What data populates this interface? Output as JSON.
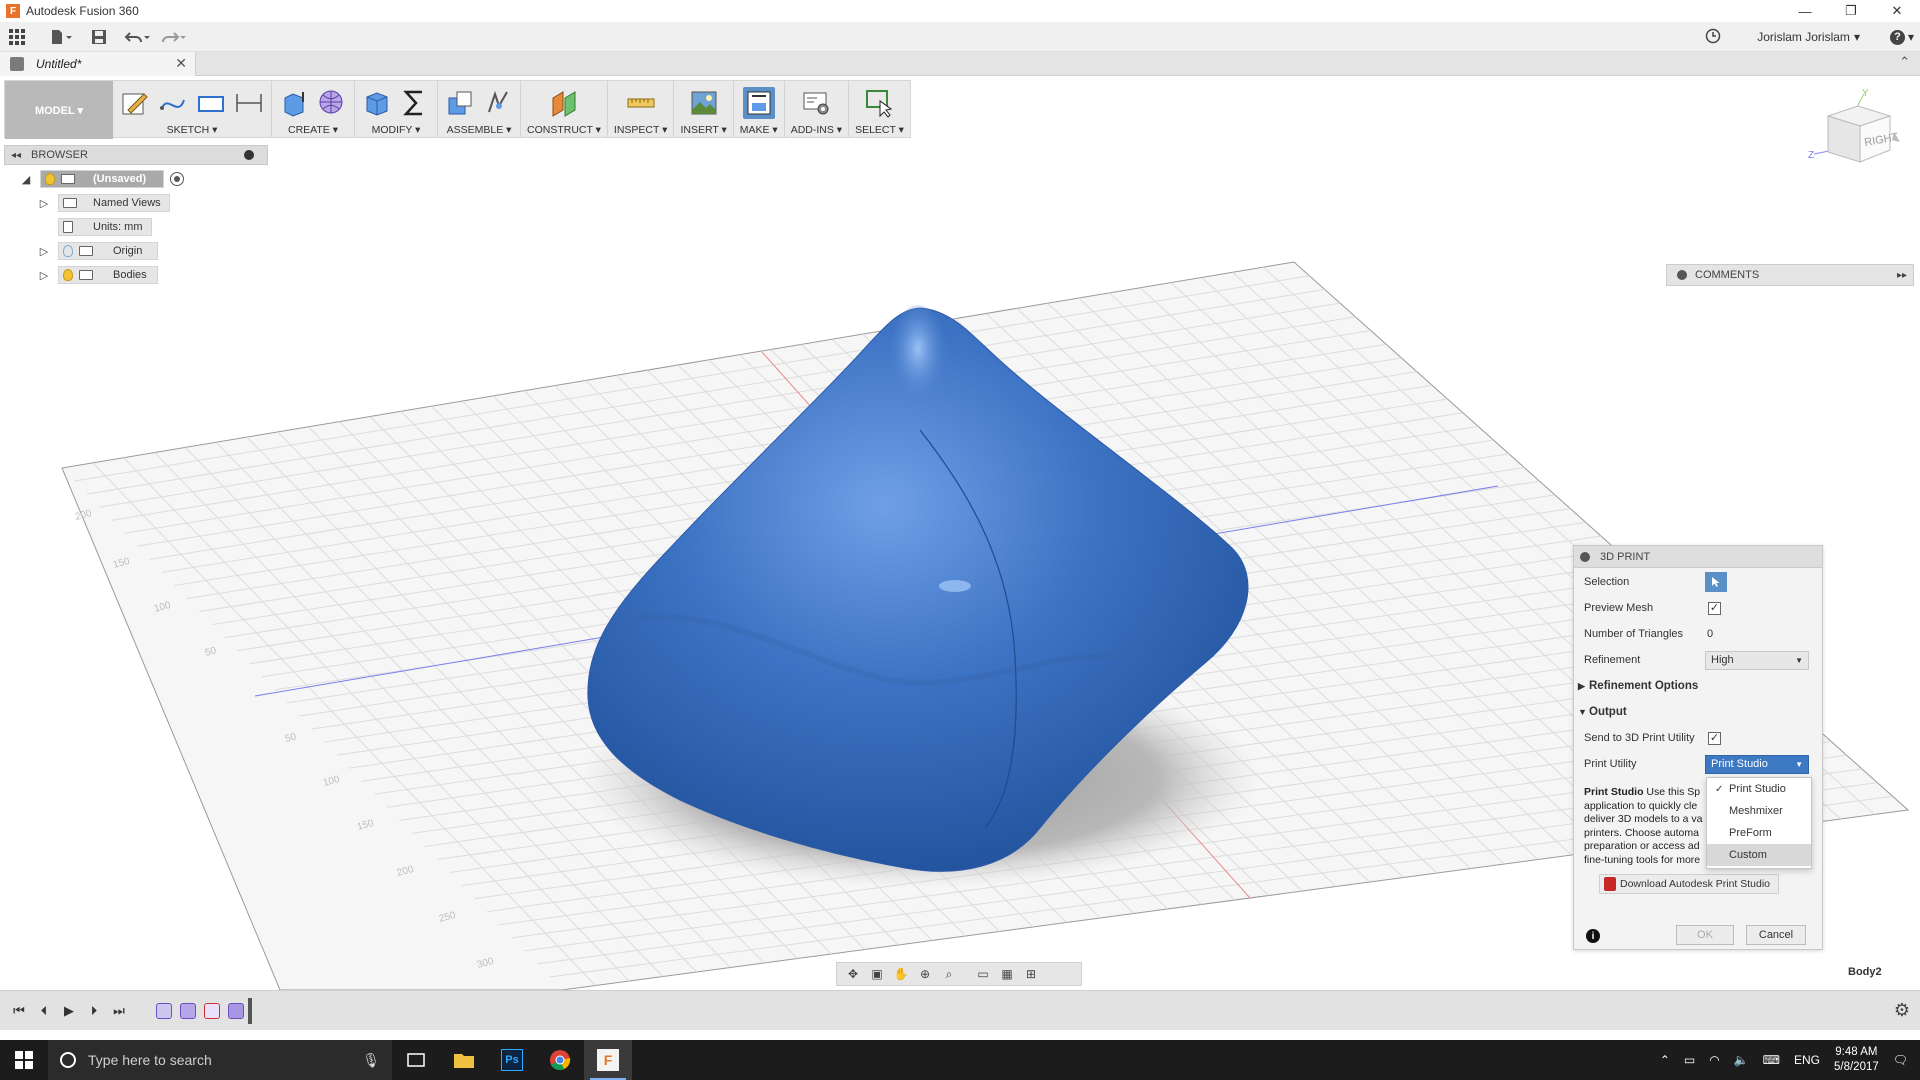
{
  "window": {
    "title": "Autodesk Fusion 360",
    "logo_letter": "F",
    "minimize": "—",
    "restore": "❐",
    "close": "✕"
  },
  "quickbar": {
    "user_name": "Jorislam Jorislam",
    "user_caret": "▾",
    "help_label": "?",
    "help_caret": "▾"
  },
  "document_tab": {
    "name": "Untitled*",
    "close": "✕",
    "collapse": "⌃"
  },
  "toolbar": {
    "mode_label": "MODEL ▾",
    "groups": [
      {
        "label": "SKETCH ▾"
      },
      {
        "label": "CREATE ▾"
      },
      {
        "label": "MODIFY ▾"
      },
      {
        "label": "ASSEMBLE ▾"
      },
      {
        "label": "CONSTRUCT ▾"
      },
      {
        "label": "INSPECT ▾"
      },
      {
        "label": "INSERT ▾"
      },
      {
        "label": "MAKE ▾"
      },
      {
        "label": "ADD-INS ▾"
      },
      {
        "label": "SELECT ▾"
      }
    ]
  },
  "browser": {
    "back": "◂◂",
    "title": "BROWSER",
    "tree": [
      {
        "label": "(Unsaved)"
      },
      {
        "label": "Named Views"
      },
      {
        "label": "Units: mm"
      },
      {
        "label": "Origin"
      },
      {
        "label": "Bodies"
      }
    ]
  },
  "viewcube": {
    "face_label": "RIGHT",
    "axis_y": "Y",
    "axis_z": "Z"
  },
  "grid_ticks": [
    "200",
    "150",
    "100",
    "50",
    "50",
    "100",
    "150",
    "200",
    "250",
    "300"
  ],
  "comments": {
    "title": "COMMENTS",
    "expand": "▸▸"
  },
  "print_dialog": {
    "title": "3D PRINT",
    "selection_label": "Selection",
    "preview_mesh_label": "Preview Mesh",
    "preview_mesh_checked": "✓",
    "triangles_label": "Number of Triangles",
    "triangles_value": "0",
    "refinement_label": "Refinement",
    "refinement_value": "High",
    "refinement_options_label": "Refinement Options",
    "output_label": "Output",
    "send_label": "Send to 3D Print Utility",
    "send_checked": "✓",
    "utility_label": "Print Utility",
    "utility_value": "Print Studio",
    "description_bold": "Print Studio",
    "description_text": "Use this Sp application to quickly cle deliver 3D models to a va printers. Choose automa preparation or access ad fine-tuning tools for more",
    "download_label": "Download Autodesk Print Studio",
    "info": "i",
    "ok_label": "OK",
    "cancel_label": "Cancel"
  },
  "utility_dropdown": {
    "check": "✓",
    "options": [
      "Print Studio",
      "Meshmixer",
      "PreForm",
      "Custom"
    ]
  },
  "status": {
    "body_name": "Body2"
  },
  "taskbar": {
    "search_placeholder": "Type here to search",
    "lang": "ENG",
    "time": "9:48 AM",
    "date": "5/8/2017"
  },
  "colors": {
    "accent_blue": "#3d78c2",
    "body_blue": "#3f72c0",
    "taskbar": "#1c1c1c"
  }
}
